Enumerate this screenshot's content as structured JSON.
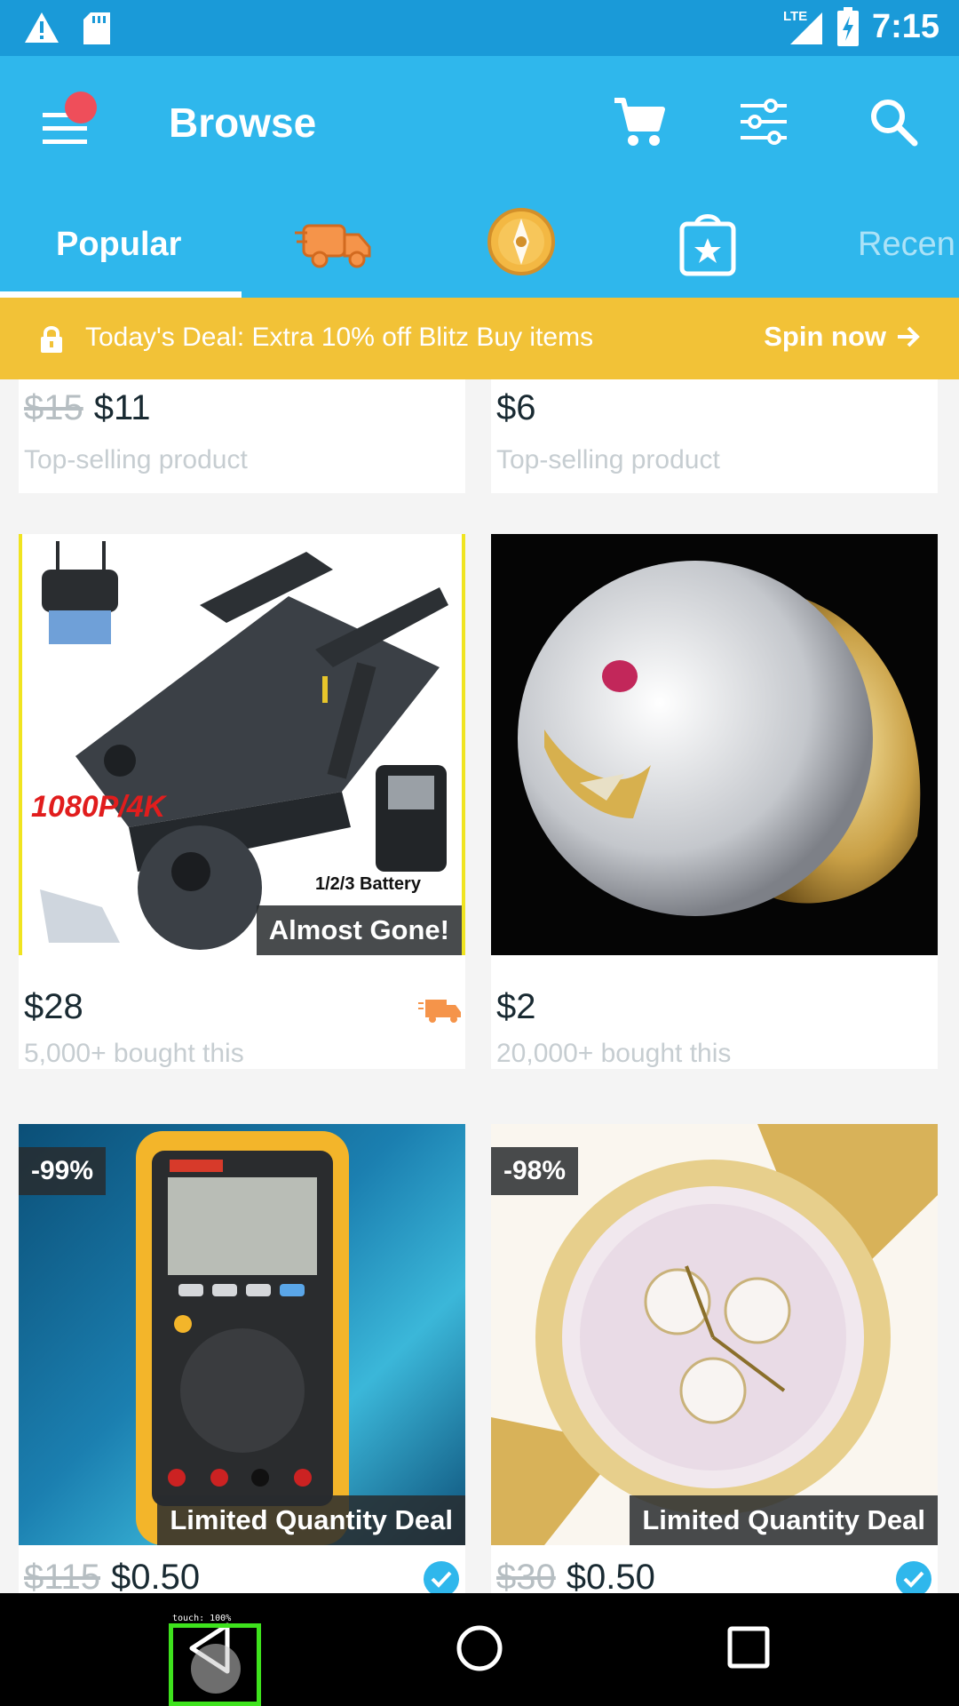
{
  "status_bar": {
    "time": "7:15",
    "network": "LTE"
  },
  "app_bar": {
    "title": "Browse"
  },
  "tabs": {
    "popular": "Popular",
    "recent": "Recen"
  },
  "deal_banner": {
    "text": "Today's Deal: Extra 10% off Blitz Buy items",
    "action": "Spin now"
  },
  "products": [
    {
      "old_price": "$15",
      "price": "$11",
      "note": "Top-selling product"
    },
    {
      "old_price": "",
      "price": "$6",
      "note": "Top-selling product"
    },
    {
      "price": "$28",
      "note": "5,000+ bought this",
      "tag": "Almost Gone!",
      "img_text_1": "1080P/4K",
      "img_text_2": "1/2/3 Battery"
    },
    {
      "price": "$2",
      "note": "20,000+ bought this"
    },
    {
      "discount": "-99%",
      "tag": "Limited Quantity Deal",
      "old_price": "$115",
      "price": "$0.50"
    },
    {
      "discount": "-98%",
      "tag": "Limited Quantity Deal",
      "old_price": "$30",
      "price": "$0.50"
    }
  ],
  "overlay": {
    "touch_label": "touch: 100%"
  },
  "colors": {
    "status_bar": "#1a9ad8",
    "app_bar": "#2fb7ec",
    "deal_banner": "#f2c237",
    "verified": "#2fb7ec",
    "truck": "#f5944a"
  }
}
